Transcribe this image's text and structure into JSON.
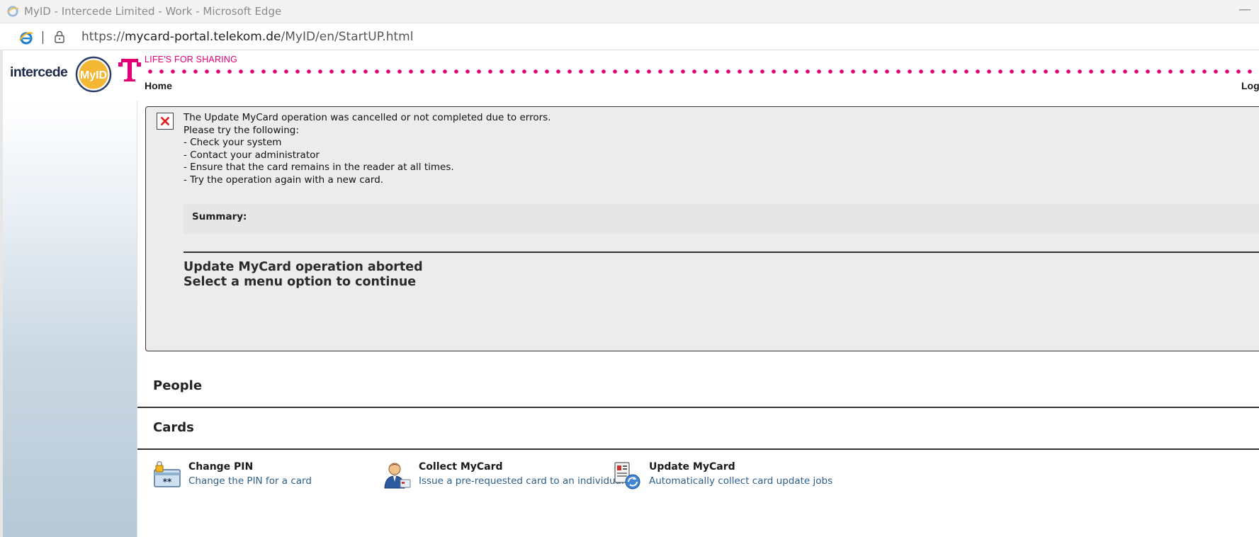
{
  "window": {
    "title": "MyID - Intercede Limited - Work - Microsoft Edge",
    "minimize_glyph": "—"
  },
  "address_bar": {
    "url_prefix": "https://",
    "url_domain": "mycard-portal.telekom.de",
    "url_path": "/MyID/en/StartUP.html"
  },
  "header": {
    "logo_text": "intercede",
    "logo_badge": "MyID",
    "brand_letter": "T",
    "slogan": "LIFE'S FOR SHARING",
    "nav_home": "Home",
    "nav_logout": "Logout"
  },
  "error": {
    "icon": "error-x-icon",
    "lines": [
      "The Update MyCard operation was cancelled or not completed due to errors.",
      "Please try the following:",
      "- Check your system",
      "- Contact your administrator",
      "- Ensure that the card remains in the reader at all times.",
      "- Try the operation again with a new card."
    ],
    "summary_label": "Summary:",
    "result_line1": "Update MyCard operation aborted",
    "result_line2": "Select a menu option to continue"
  },
  "sections": [
    {
      "title": "People"
    },
    {
      "title": "Cards"
    }
  ],
  "tasks": [
    {
      "name": "Change PIN",
      "desc": "Change the PIN for a card",
      "icon": "change-pin-icon"
    },
    {
      "name": "Collect MyCard",
      "desc": "Issue a pre-requested card to an individual",
      "icon": "collect-card-icon"
    },
    {
      "name": "Update MyCard",
      "desc": "Automatically collect card update jobs",
      "icon": "update-card-icon"
    }
  ],
  "colors": {
    "brand_magenta": "#e20074",
    "link_blue": "#2c5f8a",
    "panel_bg": "#ececec"
  }
}
